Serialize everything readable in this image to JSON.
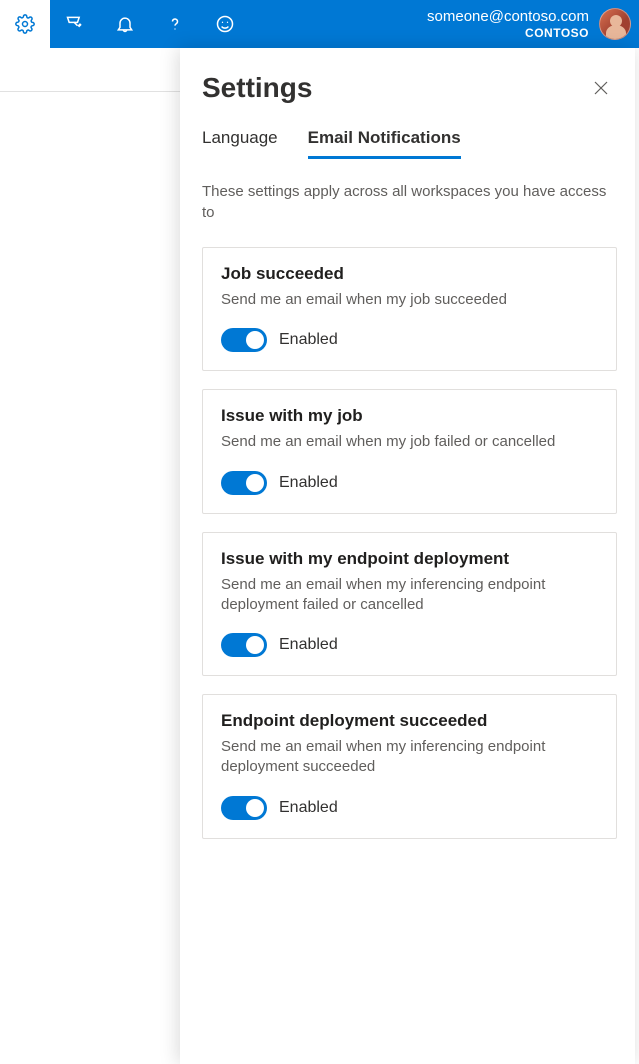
{
  "header": {
    "user_email": "someone@contoso.com",
    "org": "CONTOSO"
  },
  "panel": {
    "title": "Settings",
    "tabs": [
      {
        "label": "Language",
        "active": false
      },
      {
        "label": "Email Notifications",
        "active": true
      }
    ],
    "description": "These settings apply across all workspaces you have access to",
    "cards": [
      {
        "title": "Job succeeded",
        "desc": "Send me an email when my job succeeded",
        "state_label": "Enabled"
      },
      {
        "title": "Issue with my job",
        "desc": "Send me an email when my job failed or cancelled",
        "state_label": "Enabled"
      },
      {
        "title": "Issue with my endpoint deployment",
        "desc": "Send me an email when my inferencing endpoint deployment failed or cancelled",
        "state_label": "Enabled"
      },
      {
        "title": "Endpoint deployment succeeded",
        "desc": "Send me an email when my inferencing endpoint deployment succeeded",
        "state_label": "Enabled"
      }
    ]
  }
}
